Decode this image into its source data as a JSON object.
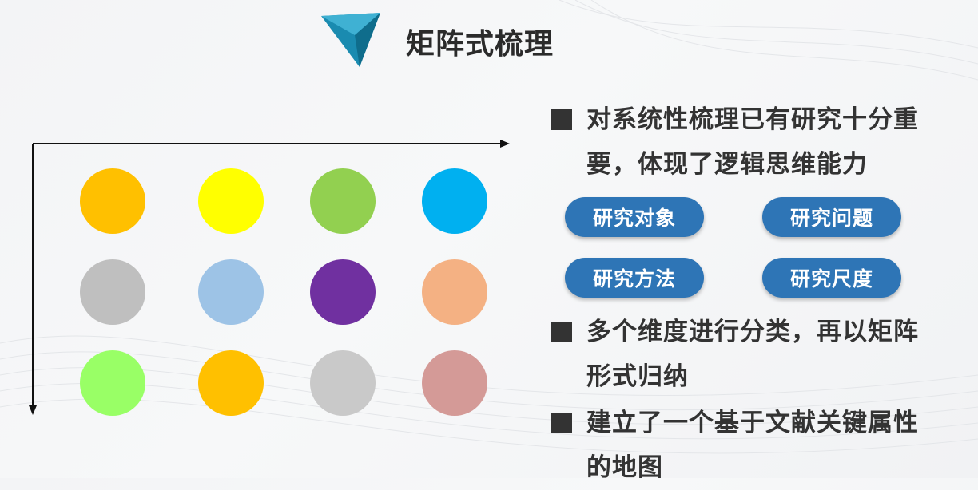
{
  "slide": {
    "title": "矩阵式梳理"
  },
  "matrix": {
    "dots": [
      {
        "color": "#ffc000"
      },
      {
        "color": "#ffff00"
      },
      {
        "color": "#92d050"
      },
      {
        "color": "#00b0f0"
      },
      {
        "color": "#bfbfbf"
      },
      {
        "color": "#9dc3e6"
      },
      {
        "color": "#7030a0"
      },
      {
        "color": "#f4b183"
      },
      {
        "color": "#99ff66"
      },
      {
        "color": "#ffc000"
      },
      {
        "color": "#c9c9c9"
      },
      {
        "color": "#d49a97"
      }
    ]
  },
  "bullets": [
    {
      "text": "对系统性梳理已有研究十分重要，体现了逻辑思维能力"
    },
    {
      "text": "多个维度进行分类，再以矩阵形式归纳"
    },
    {
      "text": "建立了一个基于文献关键属性的地图"
    }
  ],
  "tags": [
    {
      "label": "研究对象"
    },
    {
      "label": "研究问题"
    },
    {
      "label": "研究方法"
    },
    {
      "label": "研究尺度"
    }
  ],
  "colors": {
    "pill": "#2e75b6",
    "title_icon": "#1a8bb0",
    "text": "#333333"
  }
}
